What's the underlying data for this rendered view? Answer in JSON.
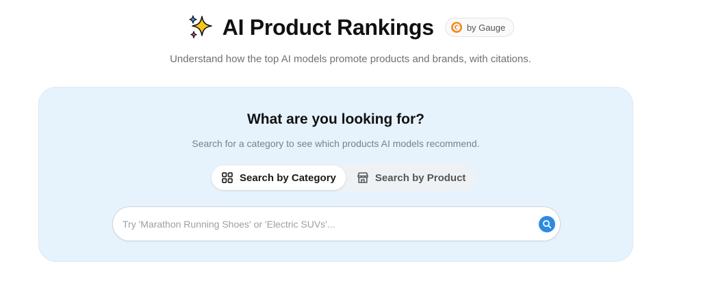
{
  "header": {
    "title": "AI Product Rankings",
    "badge_label": "by Gauge",
    "subtitle": "Understand how the top AI models promote products and brands, with citations."
  },
  "search_card": {
    "heading": "What are you looking for?",
    "subheading": "Search for a category to see which products AI models recommend.",
    "tabs": [
      {
        "label": "Search by Category",
        "icon": "grid-icon",
        "active": true
      },
      {
        "label": "Search by Product",
        "icon": "store-icon",
        "active": false
      }
    ],
    "search": {
      "placeholder": "Try 'Marathon Running Shoes' or 'Electric SUVs'...",
      "value": ""
    }
  },
  "colors": {
    "card_background": "#e6f3fc",
    "accent_blue": "#2d8be0",
    "gauge_orange": "#f08a24"
  }
}
